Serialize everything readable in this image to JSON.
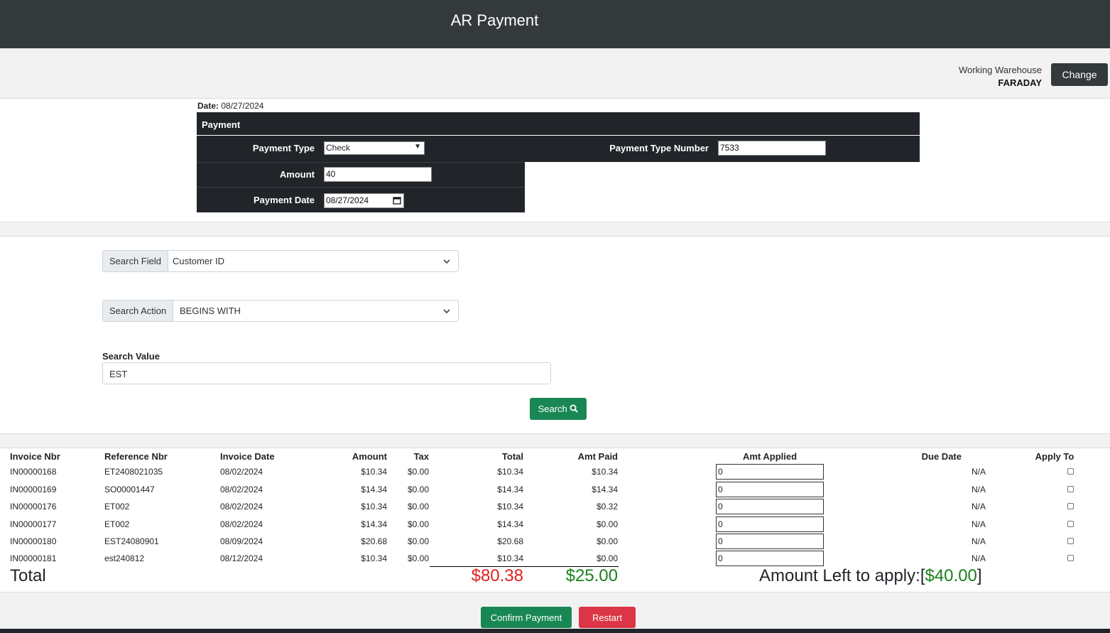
{
  "header": {
    "title": "AR Payment"
  },
  "warehouse": {
    "label": "Working Warehouse",
    "name": "FARADAY",
    "change_label": "Change"
  },
  "date": {
    "label": "Date:",
    "value": "08/27/2024"
  },
  "payment": {
    "heading": "Payment",
    "type_label": "Payment Type",
    "type_value": "Check",
    "type_number_label": "Payment Type Number",
    "type_number_value": "7533",
    "amount_label": "Amount",
    "amount_value": "40",
    "date_label": "Payment Date",
    "date_value": "08/27/2024"
  },
  "search": {
    "field_label": "Search Field",
    "field_value": "Customer ID",
    "action_label": "Search Action",
    "action_value": "BEGINS WITH",
    "value_label": "Search Value",
    "value_value": "EST",
    "button_label": "Search"
  },
  "table": {
    "headers": [
      "Invoice Nbr",
      "Reference Nbr",
      "Invoice Date",
      "Amount",
      "Tax",
      "Total",
      "Amt Paid",
      "Amt Applied",
      "Due Date",
      "Apply To"
    ],
    "rows": [
      {
        "invoice": "IN00000168",
        "ref": "ET2408021035",
        "date": "08/02/2024",
        "amount": "$10.34",
        "tax": "$0.00",
        "total": "$10.34",
        "paid": "$10.34",
        "applied": "0",
        "due": "N/A"
      },
      {
        "invoice": "IN00000169",
        "ref": "SO00001447",
        "date": "08/02/2024",
        "amount": "$14.34",
        "tax": "$0.00",
        "total": "$14.34",
        "paid": "$14.34",
        "applied": "0",
        "due": "N/A"
      },
      {
        "invoice": "IN00000176",
        "ref": "ET002",
        "date": "08/02/2024",
        "amount": "$10.34",
        "tax": "$0.00",
        "total": "$10.34",
        "paid": "$0.32",
        "applied": "0",
        "due": "N/A"
      },
      {
        "invoice": "IN00000177",
        "ref": "ET002",
        "date": "08/02/2024",
        "amount": "$14.34",
        "tax": "$0.00",
        "total": "$14.34",
        "paid": "$0.00",
        "applied": "0",
        "due": "N/A"
      },
      {
        "invoice": "IN00000180",
        "ref": "EST24080901",
        "date": "08/09/2024",
        "amount": "$20.68",
        "tax": "$0.00",
        "total": "$20.68",
        "paid": "$0.00",
        "applied": "0",
        "due": "N/A"
      },
      {
        "invoice": "IN00000181",
        "ref": "est240812",
        "date": "08/12/2024",
        "amount": "$10.34",
        "tax": "$0.00",
        "total": "$10.34",
        "paid": "$0.00",
        "applied": "0",
        "due": "N/A"
      }
    ],
    "total_label": "Total",
    "total_value": "$80.38",
    "paid_value": "$25.00",
    "left_label": "Amount Left to apply:",
    "left_value": "$40.00",
    "left_open": "[",
    "left_close": "]"
  },
  "actions": {
    "confirm_label": "Confirm Payment",
    "restart_label": "Restart"
  },
  "colors": {
    "dark": "#343a3b",
    "success": "#198754",
    "danger": "#dc3545",
    "total_red": "#e02020",
    "paid_green": "#1a7f1a"
  }
}
